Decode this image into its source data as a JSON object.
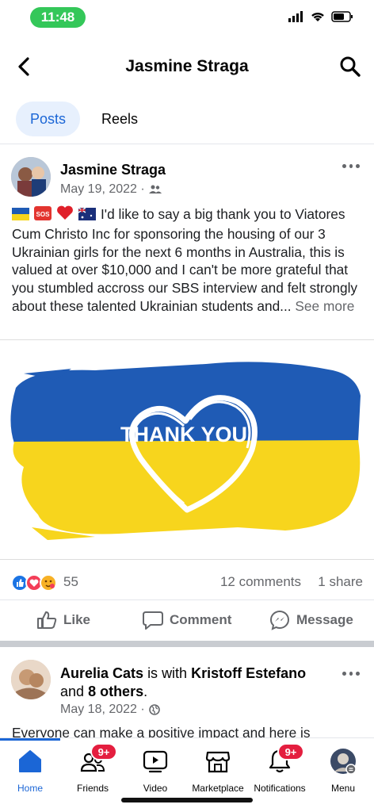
{
  "status_bar": {
    "time": "11:48"
  },
  "header": {
    "title": "Jasmine Straga"
  },
  "tabs": [
    {
      "label": "Posts",
      "active": true
    },
    {
      "label": "Reels",
      "active": false
    }
  ],
  "post": {
    "author": "Jasmine Straga",
    "date": "May 19, 2022 ·",
    "text": "I'd like to say a big thank you to Viatores Cum Christo Inc for sponsoring the housing of our 3 Ukrainian girls for the next 6 months in Australia, this is valued at over $10,000 and I can't be more grateful that you stumbled accross our SBS interview and felt strongly about these talented Ukrainian students and...",
    "see_more": "See more",
    "image_text": "THANK YOU",
    "reaction_count": "55",
    "comments": "12 comments",
    "shares": "1 share",
    "actions": {
      "like": "Like",
      "comment": "Comment",
      "message": "Message"
    }
  },
  "post2": {
    "author": "Aurelia Cats",
    "with_text": "is with",
    "tagged": "Kristoff Estefano",
    "and_text": "and",
    "others": "8 others",
    "period": ".",
    "date": "May 18, 2022 ·",
    "text": "Everyone can make a positive impact and here is"
  },
  "bottom_nav": {
    "items": [
      {
        "label": "Home",
        "icon": "home-icon",
        "active": true
      },
      {
        "label": "Friends",
        "icon": "friends-icon",
        "badge": "9+"
      },
      {
        "label": "Video",
        "icon": "video-icon"
      },
      {
        "label": "Marketplace",
        "icon": "marketplace-icon"
      },
      {
        "label": "Notifications",
        "icon": "bell-icon",
        "badge": "9+"
      },
      {
        "label": "Menu",
        "icon": "menu-avatar-icon"
      }
    ]
  },
  "colors": {
    "accent": "#1b66d6",
    "badge": "#e41e3f",
    "ukraine_blue": "#1f5bb5",
    "ukraine_yellow": "#f7d51d",
    "status_green": "#34c759"
  }
}
